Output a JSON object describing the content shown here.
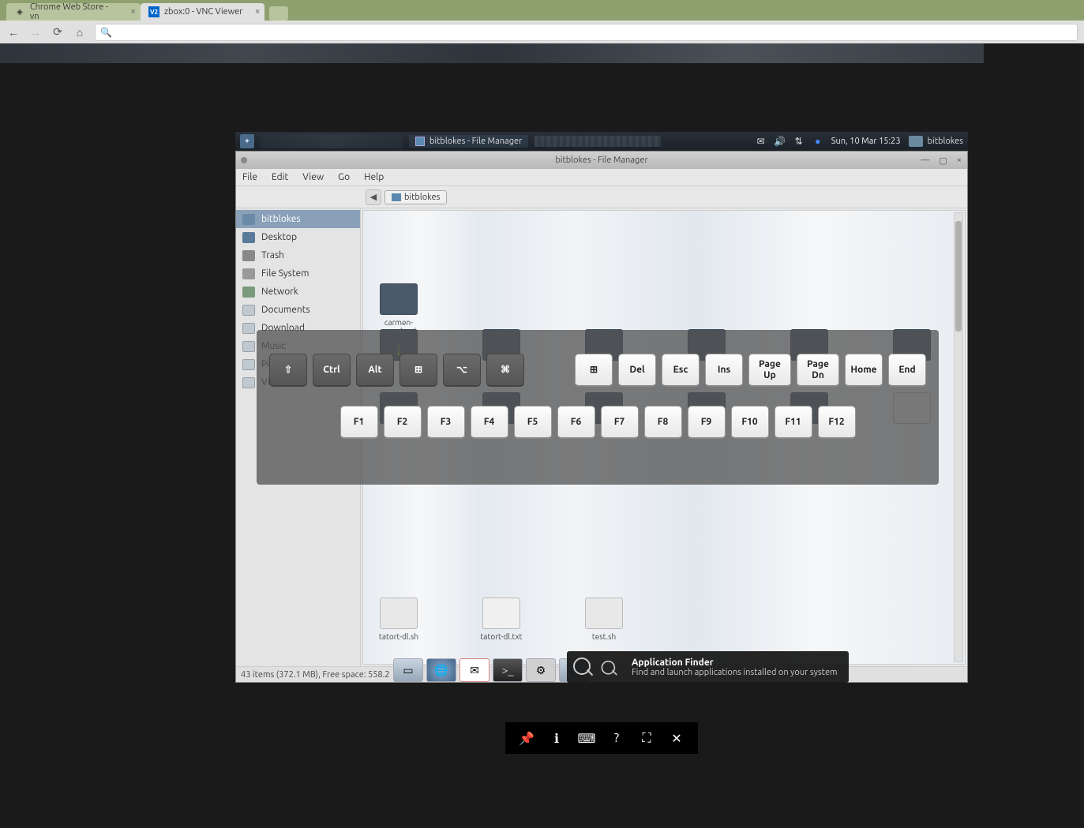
{
  "browser": {
    "tabs": [
      {
        "label": "Chrome Web Store - vn",
        "active": false
      },
      {
        "label": "zbox:0 - VNC Viewer",
        "active": true
      }
    ]
  },
  "xfce_panel": {
    "task_label": "bitblokes - File Manager",
    "clock": "Sun, 10 Mar  15:23",
    "user": "bitblokes"
  },
  "fm": {
    "title": "bitblokes - File Manager",
    "menus": [
      "File",
      "Edit",
      "View",
      "Go",
      "Help"
    ],
    "path_crumb": "bitblokes",
    "sidebar": [
      "bitblokes",
      "Desktop",
      "Trash",
      "File System",
      "Network",
      "Documents",
      "Download",
      "Music",
      "Pictures",
      "Vi"
    ],
    "row1": [
      "carmen-owncloud"
    ],
    "row3": [
      "tatort-dl.sh",
      "tatort-dl.txt",
      "test.sh"
    ],
    "status": "43 items (372.1 MB), Free space: 558.2"
  },
  "tooltip": {
    "title": "Application Finder",
    "sub": "Find and launch applications installed on your system"
  },
  "vkbd": {
    "row1_mod": [
      "⇧",
      "Ctrl",
      "Alt",
      "⊞",
      "⌥",
      "⌘"
    ],
    "row1_keys": [
      "⊞",
      "Del",
      "Esc",
      "Ins",
      "Page Up",
      "Page Dn",
      "Home",
      "End"
    ],
    "row2": [
      "F1",
      "F2",
      "F3",
      "F4",
      "F5",
      "F6",
      "F7",
      "F8",
      "F9",
      "F10",
      "F11",
      "F12"
    ]
  }
}
